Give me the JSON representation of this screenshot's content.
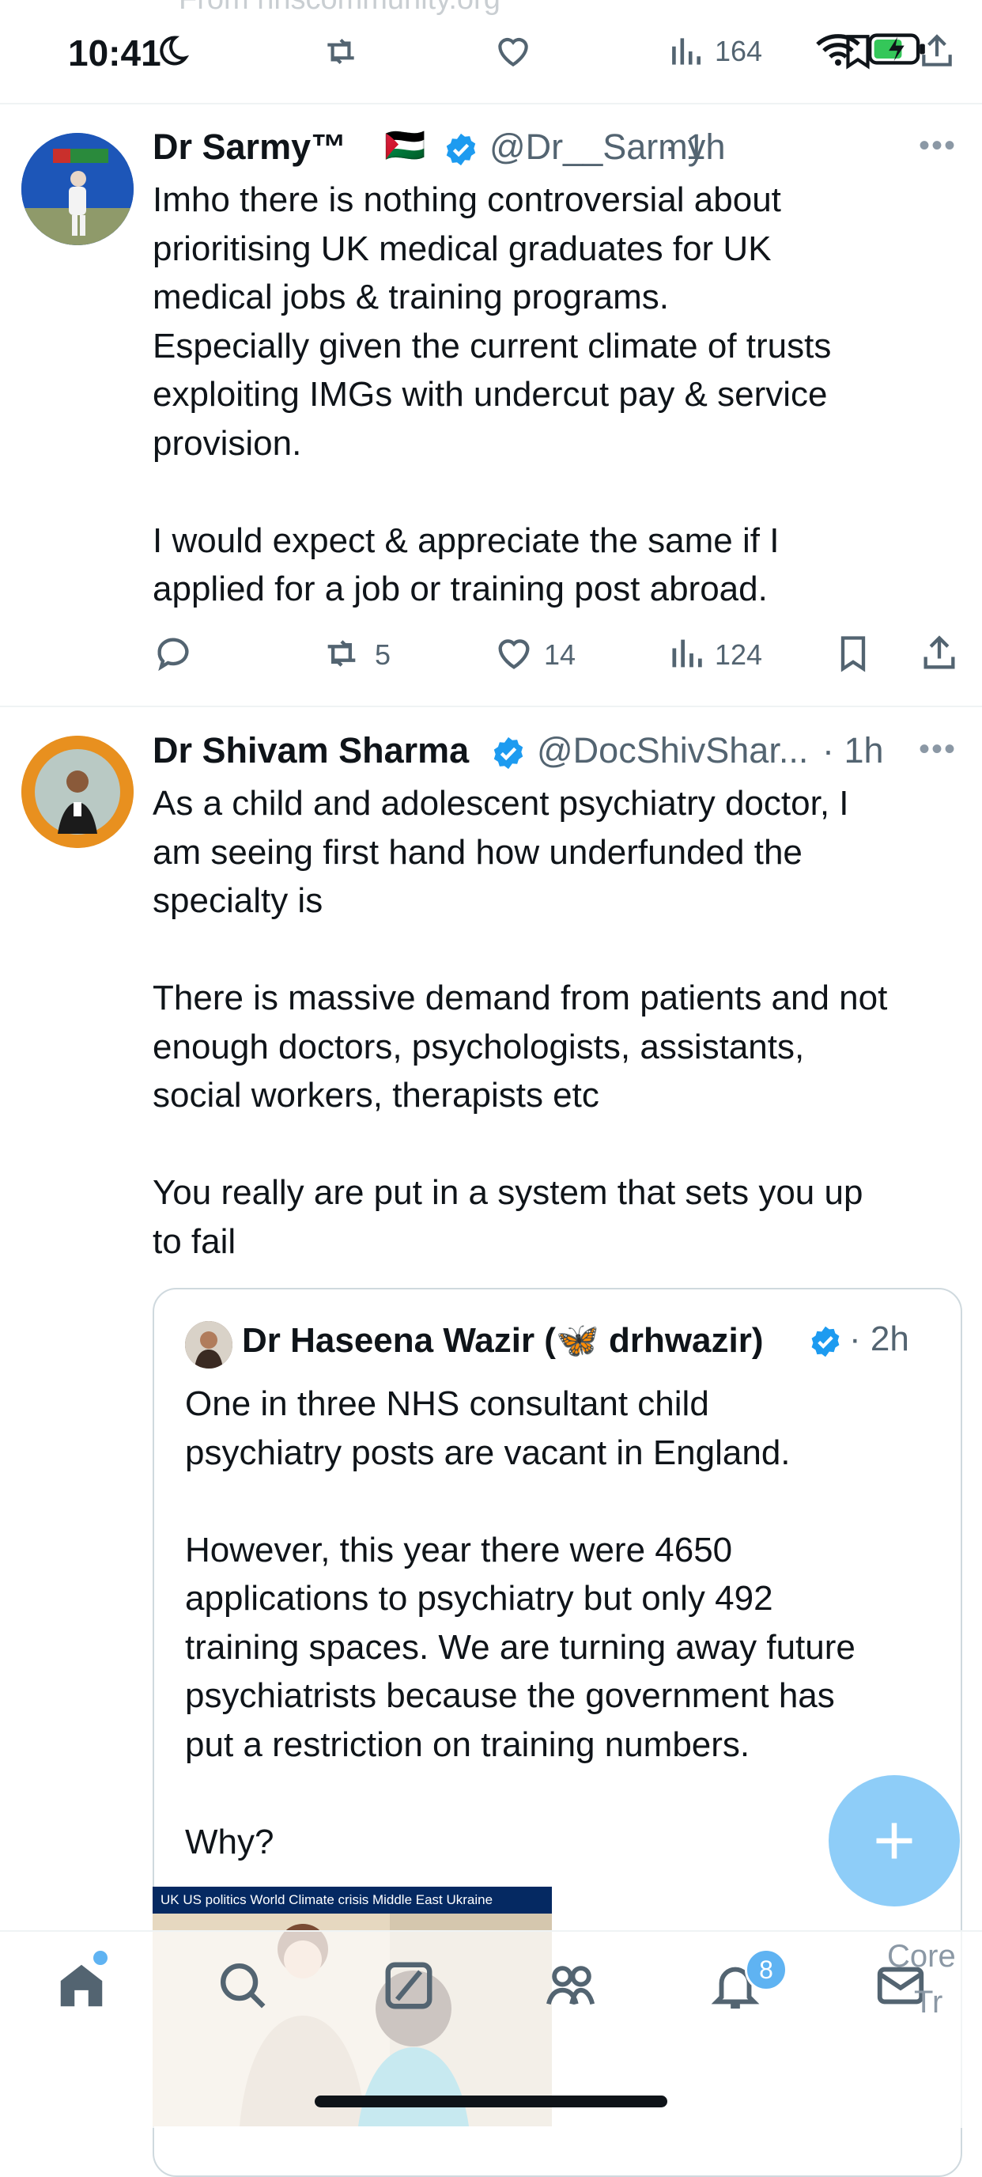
{
  "status": {
    "time": "10:41",
    "ghost_url": "From nhscommunity.org",
    "views_count": "164"
  },
  "tweets": [
    {
      "name": "Dr Sarmy™",
      "flag": "🇵🇸",
      "handle": "@Dr__Sarmy",
      "time": "· 1h",
      "text": "Imho there is nothing controversial about\nprioritising UK medical graduates for UK\nmedical jobs & training programs.\nEspecially given the current climate of trusts\nexploiting IMGs with undercut pay & service\nprovision.\n\nI would expect & appreciate the same if I\napplied for a job or training post abroad.",
      "retweets": "5",
      "likes": "14",
      "views": "124"
    },
    {
      "name": "Dr Shivam Sharma",
      "handle": "@DocShivShar...",
      "time": "· 1h",
      "text": "As a child and adolescent psychiatry doctor, I\nam seeing first hand how underfunded the\nspecialty is\n\nThere is massive demand from patients and not\nenough doctors, psychologists, assistants,\nsocial workers, therapists etc\n\nYou really are put in a system that sets you up\nto fail"
    }
  ],
  "quote": {
    "name": "Dr Haseena Wazir (🦋 drhwazir)",
    "time": "· 2h",
    "text": "One in three NHS consultant child\npsychiatry posts are vacant in England.\n\nHowever, this year there were 4650\napplications to psychiatry but only 492\ntraining spaces. We are turning away future\npsychiatrists because the government has\nput a restriction on training numbers.\n\nWhy?"
  },
  "news_image": {
    "nav_text": "UK   US politics   World   Climate crisis   Middle East   Ukraine"
  },
  "tabbar": {
    "notifications_badge": "8",
    "core_text_1": "Core",
    "core_text_2": "Tr"
  },
  "icons": [
    "reply-icon",
    "retweet-icon",
    "like-icon",
    "views-icon",
    "bookmark-icon",
    "share-icon",
    "verified-icon",
    "home-icon",
    "search-icon",
    "grok-icon",
    "communities-icon",
    "bell-icon",
    "mail-icon",
    "compose-plus-icon"
  ],
  "colors": {
    "accent": "#1d9bf0",
    "fab": "#8ecdf8",
    "secondary_text": "#536471"
  }
}
